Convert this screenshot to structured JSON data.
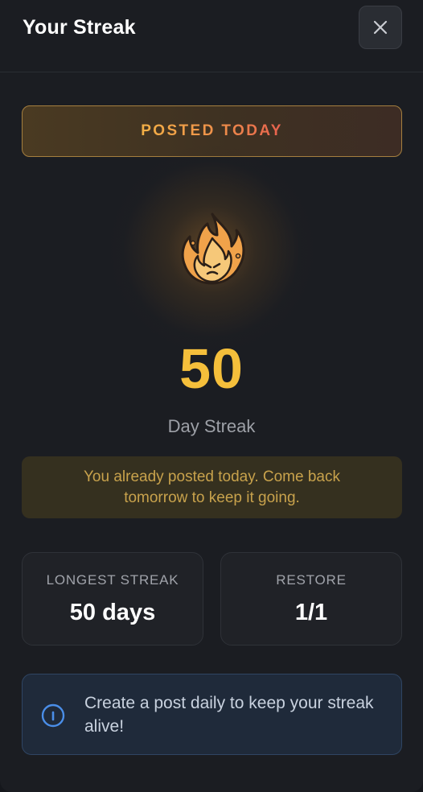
{
  "header": {
    "title": "Your Streak",
    "close_icon": "close-icon"
  },
  "banner": {
    "label": "POSTED TODAY"
  },
  "streak": {
    "icon": "flame-icon",
    "count": "50",
    "label": "Day Streak"
  },
  "notice": {
    "message": "You already posted today. Come back tomorrow to keep it going."
  },
  "stats": {
    "longest": {
      "label": "LONGEST STREAK",
      "value": "50 days"
    },
    "restore": {
      "label": "RESTORE",
      "value": "1/1"
    }
  },
  "info": {
    "icon": "info-icon",
    "message": "Create a post daily to keep your streak alive!"
  },
  "colors": {
    "accent_gold": "#f5bf3b",
    "banner_gradient_start": "#f3b046",
    "banner_gradient_end": "#e8604e",
    "info_blue": "#4a8ee8",
    "background": "#1b1d22"
  }
}
